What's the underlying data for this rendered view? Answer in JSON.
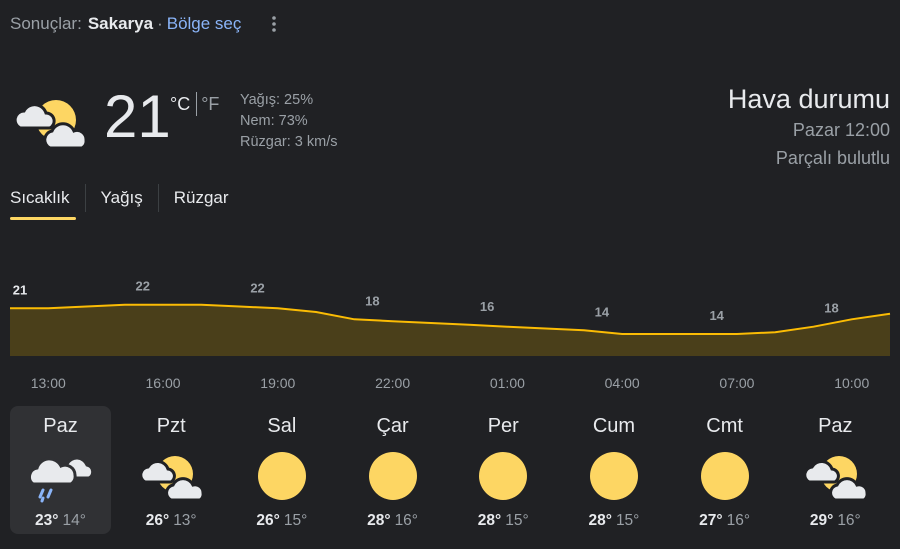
{
  "header": {
    "results_label": "Sonuçlar:",
    "location": "Sakarya",
    "separator": "·",
    "select_region": "Bölge seç"
  },
  "current": {
    "icon": "partly-cloudy-icon",
    "temperature": "21",
    "unit_c": "°C",
    "unit_f": "°F",
    "precipitation": "Yağış: 25%",
    "humidity": "Nem: 73%",
    "wind": "Rüzgar: 3 km/s"
  },
  "summary": {
    "title": "Hava durumu",
    "time": "Pazar 12:00",
    "condition": "Parçalı bulutlu"
  },
  "tabs": [
    {
      "label": "Sıcaklık",
      "active": true
    },
    {
      "label": "Yağış",
      "active": false
    },
    {
      "label": "Rüzgar",
      "active": false
    }
  ],
  "chart_data": {
    "type": "area",
    "x": [
      "12:00",
      "13:00",
      "14:00",
      "15:00",
      "16:00",
      "17:00",
      "18:00",
      "19:00",
      "20:00",
      "21:00",
      "22:00",
      "23:00",
      "00:00",
      "01:00",
      "02:00",
      "03:00",
      "04:00",
      "05:00",
      "06:00",
      "07:00",
      "08:00",
      "09:00",
      "10:00",
      "11:00"
    ],
    "values": [
      21,
      21,
      21.5,
      22,
      22,
      22,
      21.5,
      21,
      20,
      18,
      17.5,
      17,
      16.5,
      16,
      15.5,
      15,
      14,
      14,
      14,
      14,
      14.5,
      16,
      18,
      19.5
    ],
    "data_labels": [
      {
        "x": "12:00",
        "value": "21"
      },
      {
        "x": "15:00",
        "value": "22"
      },
      {
        "x": "18:00",
        "value": "22"
      },
      {
        "x": "21:00",
        "value": "18"
      },
      {
        "x": "00:00",
        "value": "16"
      },
      {
        "x": "03:00",
        "value": "14"
      },
      {
        "x": "06:00",
        "value": "14"
      },
      {
        "x": "09:00",
        "value": "18"
      }
    ],
    "tick_labels": [
      "13:00",
      "16:00",
      "19:00",
      "22:00",
      "01:00",
      "04:00",
      "07:00",
      "10:00"
    ],
    "line_color": "#fbbc04",
    "fill_color": "#4a3f1a",
    "ylim": [
      8,
      26
    ]
  },
  "days": [
    {
      "name": "Paz",
      "icon": "rain-cloud-icon",
      "hi": "23°",
      "lo": "14°",
      "selected": true
    },
    {
      "name": "Pzt",
      "icon": "partly-cloudy-icon",
      "hi": "26°",
      "lo": "13°",
      "selected": false
    },
    {
      "name": "Sal",
      "icon": "sun-icon",
      "hi": "26°",
      "lo": "15°",
      "selected": false
    },
    {
      "name": "Çar",
      "icon": "sun-icon",
      "hi": "28°",
      "lo": "16°",
      "selected": false
    },
    {
      "name": "Per",
      "icon": "sun-icon",
      "hi": "28°",
      "lo": "15°",
      "selected": false
    },
    {
      "name": "Cum",
      "icon": "sun-icon",
      "hi": "28°",
      "lo": "15°",
      "selected": false
    },
    {
      "name": "Cmt",
      "icon": "sun-icon",
      "hi": "27°",
      "lo": "16°",
      "selected": false
    },
    {
      "name": "Paz",
      "icon": "partly-cloudy-icon",
      "hi": "29°",
      "lo": "16°",
      "selected": false
    }
  ],
  "colors": {
    "background": "#202124",
    "accent": "#fdd663",
    "link": "#8ab4f8",
    "sun": "#fdd663",
    "cloud": "#e8eaed"
  }
}
